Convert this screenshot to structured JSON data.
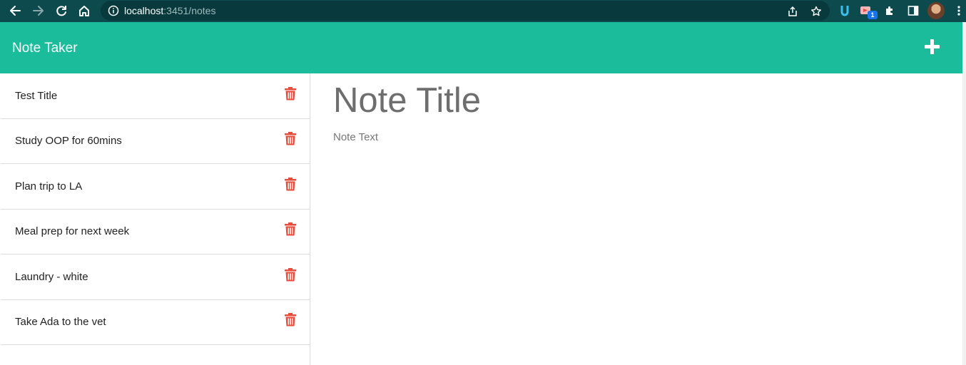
{
  "browser": {
    "url_host": "localhost",
    "url_rest": ":3451/notes",
    "extension_badge": "1",
    "icons": [
      "back-icon",
      "forward-icon",
      "reload-icon",
      "home-icon",
      "info-icon",
      "share-icon",
      "star-icon",
      "extension-icon",
      "puzzle-icon",
      "side-panel-icon",
      "avatar",
      "menu-icon"
    ]
  },
  "app": {
    "brand": "Note Taker",
    "accent": "#1abc9c",
    "delete_color": "#e74c3c"
  },
  "notes": [
    {
      "title": "Test Title"
    },
    {
      "title": "Study OOP for 60mins"
    },
    {
      "title": "Plan trip to LA"
    },
    {
      "title": "Meal prep for next week"
    },
    {
      "title": "Laundry - white"
    },
    {
      "title": "Take Ada to the vet"
    }
  ],
  "editor": {
    "title_placeholder": "Note Title",
    "text_placeholder": "Note Text"
  }
}
